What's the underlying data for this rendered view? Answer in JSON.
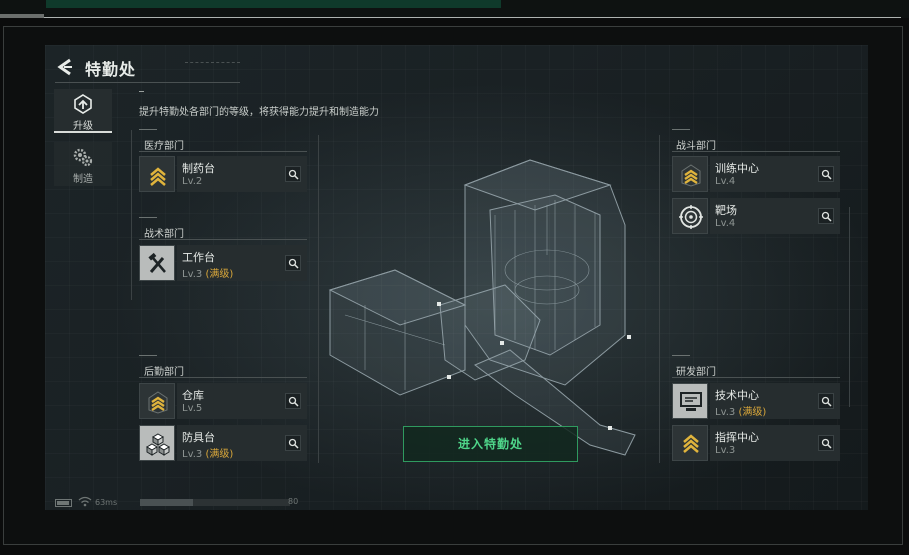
{
  "header": {
    "title": "特勤处"
  },
  "tabs": [
    {
      "label": "升级",
      "icon": "upgrade-icon",
      "active": true
    },
    {
      "label": "制造",
      "icon": "gears-icon",
      "active": false
    }
  ],
  "subtitle": "提升特勤处各部门的等级，将获得能力提升和制造能力",
  "departments": {
    "medical": {
      "title": "医疗部门",
      "items": [
        {
          "name": "制药台",
          "level": "Lv.2",
          "max": ""
        }
      ]
    },
    "tactical": {
      "title": "战术部门",
      "items": [
        {
          "name": "工作台",
          "level": "Lv.3",
          "max": "(满级)"
        }
      ]
    },
    "logistics": {
      "title": "后勤部门",
      "items": [
        {
          "name": "仓库",
          "level": "Lv.5",
          "max": ""
        },
        {
          "name": "防具台",
          "level": "Lv.3",
          "max": "(满级)"
        }
      ]
    },
    "combat": {
      "title": "战斗部门",
      "items": [
        {
          "name": "训练中心",
          "level": "Lv.4",
          "max": ""
        },
        {
          "name": "靶场",
          "level": "Lv.4",
          "max": ""
        }
      ]
    },
    "research": {
      "title": "研发部门",
      "items": [
        {
          "name": "技术中心",
          "level": "Lv.3",
          "max": "(满级)"
        },
        {
          "name": "指挥中心",
          "level": "Lv.3",
          "max": ""
        }
      ]
    }
  },
  "enter_button": "进入特勤处",
  "status": {
    "ping": "63ms",
    "progress_value": "80",
    "progress_fraction": 0.35
  },
  "colors": {
    "accent_green": "#4fd68a",
    "max_level": "#d9a73a",
    "rank_gold": "#e0b43c"
  }
}
